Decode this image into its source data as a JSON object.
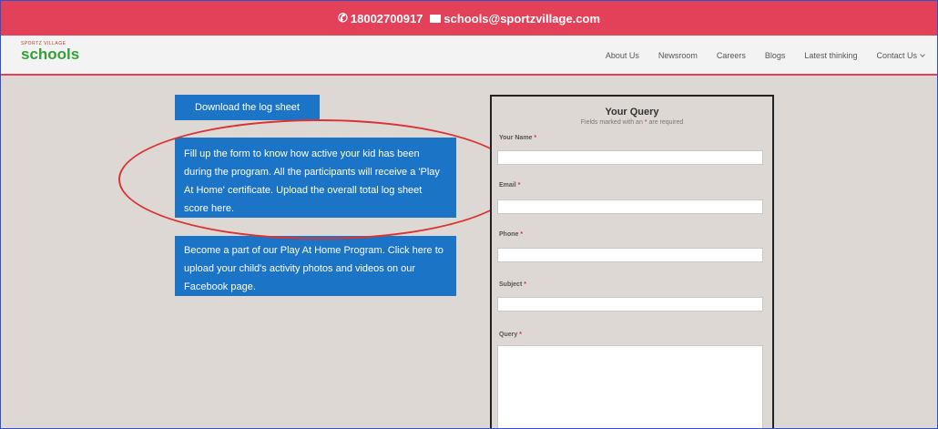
{
  "topbar": {
    "phone": "18002700917",
    "email": "schools@sportzvillage.com"
  },
  "logo": {
    "tagline": "SPORTZ VILLAGE",
    "brand": "schools"
  },
  "nav": {
    "items": [
      "About Us",
      "Newsroom",
      "Careers",
      "Blogs",
      "Latest thinking",
      "Contact Us"
    ]
  },
  "main": {
    "download_label": "Download the log sheet",
    "card1": "Fill up the form to know how active your kid has been during the program. All the participants will receive a 'Play At Home' certificate. Upload the overall total log sheet score here.",
    "card2": "Become a part of our Play At Home Program. Click here to upload your child's activity photos and videos on our Facebook page."
  },
  "form": {
    "title": "Your Query",
    "subtitle_pre": "Fields marked with an",
    "subtitle_star": "*",
    "subtitle_post": "are required",
    "fields": {
      "name": "Your Name",
      "email": "Email",
      "phone": "Phone",
      "subject": "Subject",
      "query": "Query"
    },
    "required_mark": "*"
  },
  "colors": {
    "accent": "#e3415a",
    "button": "#1b74c6",
    "annotation": "#d93333"
  }
}
